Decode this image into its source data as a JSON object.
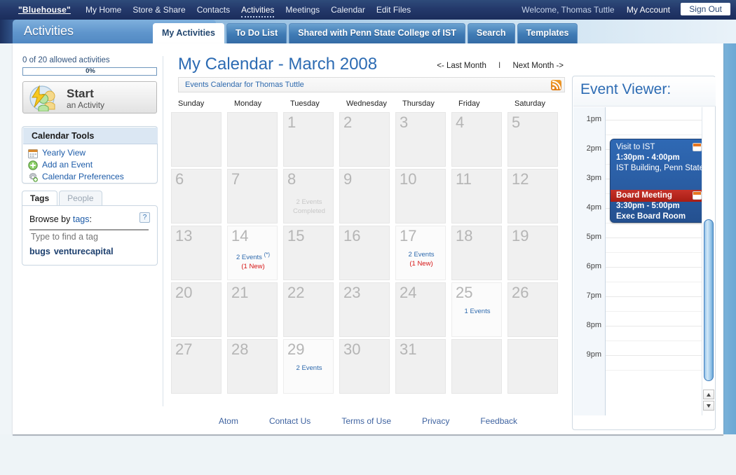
{
  "topnav": {
    "brand": "\"Bluehouse\"",
    "links": [
      {
        "label": "My Home",
        "active": false
      },
      {
        "label": "Store & Share",
        "active": false
      },
      {
        "label": "Contacts",
        "active": false
      },
      {
        "label": "Activities",
        "active": true
      },
      {
        "label": "Meetings",
        "active": false
      },
      {
        "label": "Calendar",
        "active": false
      },
      {
        "label": "Edit Files",
        "active": false
      }
    ],
    "welcome": "Welcome, Thomas Tuttle",
    "my_account": "My Account",
    "sign_out": "Sign Out"
  },
  "section": {
    "title": "Activities",
    "tabs": [
      {
        "label": "My Activities",
        "active": true
      },
      {
        "label": "To Do List",
        "active": false
      },
      {
        "label": "Shared with Penn State College of IST",
        "active": false
      },
      {
        "label": "Search",
        "active": false
      },
      {
        "label": "Templates",
        "active": false
      }
    ]
  },
  "sidebar": {
    "quota_text": "0 of 20 allowed activities",
    "quota_percent": "0%",
    "start_button": {
      "title": "Start",
      "subtitle": "an Activity",
      "icon": "start-activity-icon"
    },
    "tools_panel": {
      "heading": "Calendar Tools",
      "links": [
        {
          "label": "Yearly View",
          "icon": "calendar-icon"
        },
        {
          "label": "Add an Event",
          "icon": "plus-circle-icon"
        },
        {
          "label": "Calendar Preferences",
          "icon": "gear-icon"
        }
      ]
    },
    "tags_panel": {
      "tabs": [
        {
          "label": "Tags",
          "active": true
        },
        {
          "label": "People",
          "active": false
        }
      ],
      "browse_prefix": "Browse by ",
      "browse_link": "tags",
      "browse_suffix": ":",
      "help": "?",
      "tag_input_placeholder": "Type to find a tag",
      "tag_input_value": "",
      "tags": [
        "bugs",
        "venturecapital"
      ]
    }
  },
  "calendar": {
    "title": "My Calendar - March 2008",
    "prev_month": "<- Last Month",
    "separator": "I",
    "next_month": "Next Month ->",
    "feed_label": "Events Calendar for Thomas Tuttle",
    "feed_icon": "rss-icon",
    "day_headers": [
      "Sunday",
      "Monday",
      "Tuesday",
      "Wednesday",
      "Thursday",
      "Friday",
      "Saturday"
    ],
    "cells": [
      {
        "num": "",
        "events": "",
        "new": "",
        "star": false,
        "has": false
      },
      {
        "num": "",
        "events": "",
        "new": "",
        "star": false,
        "has": false
      },
      {
        "num": "1",
        "events": "",
        "new": "",
        "star": false,
        "has": false
      },
      {
        "num": "2",
        "events": "",
        "new": "",
        "star": false,
        "has": false
      },
      {
        "num": "3",
        "events": "",
        "new": "",
        "star": false,
        "has": false
      },
      {
        "num": "4",
        "events": "",
        "new": "",
        "star": false,
        "has": false
      },
      {
        "num": "5",
        "events": "",
        "new": "",
        "star": false,
        "has": false
      },
      {
        "num": "6",
        "events": "",
        "new": "",
        "star": false,
        "has": false
      },
      {
        "num": "7",
        "events": "",
        "new": "",
        "star": false,
        "has": false
      },
      {
        "num": "8",
        "events": "2 Events Completed",
        "new": "",
        "star": false,
        "has": false,
        "gray": true
      },
      {
        "num": "9",
        "events": "",
        "new": "",
        "star": false,
        "has": false
      },
      {
        "num": "10",
        "events": "",
        "new": "",
        "star": false,
        "has": false
      },
      {
        "num": "11",
        "events": "",
        "new": "",
        "star": false,
        "has": false
      },
      {
        "num": "12",
        "events": "",
        "new": "",
        "star": false,
        "has": false
      },
      {
        "num": "13",
        "events": "",
        "new": "",
        "star": false,
        "has": false
      },
      {
        "num": "14",
        "events": "2 Events",
        "new": "(1 New)",
        "star": true,
        "has": true
      },
      {
        "num": "15",
        "events": "",
        "new": "",
        "star": false,
        "has": false
      },
      {
        "num": "16",
        "events": "",
        "new": "",
        "star": false,
        "has": false
      },
      {
        "num": "17",
        "events": "2 Events",
        "new": "(1 New)",
        "star": false,
        "has": true
      },
      {
        "num": "18",
        "events": "",
        "new": "",
        "star": false,
        "has": false
      },
      {
        "num": "19",
        "events": "",
        "new": "",
        "star": false,
        "has": false
      },
      {
        "num": "20",
        "events": "",
        "new": "",
        "star": false,
        "has": false
      },
      {
        "num": "21",
        "events": "",
        "new": "",
        "star": false,
        "has": false
      },
      {
        "num": "22",
        "events": "",
        "new": "",
        "star": false,
        "has": false
      },
      {
        "num": "23",
        "events": "",
        "new": "",
        "star": false,
        "has": false
      },
      {
        "num": "24",
        "events": "",
        "new": "",
        "star": false,
        "has": false
      },
      {
        "num": "25",
        "events": "1 Events",
        "new": "",
        "star": false,
        "has": true
      },
      {
        "num": "26",
        "events": "",
        "new": "",
        "star": false,
        "has": false
      },
      {
        "num": "27",
        "events": "",
        "new": "",
        "star": false,
        "has": false
      },
      {
        "num": "28",
        "events": "",
        "new": "",
        "star": false,
        "has": false
      },
      {
        "num": "29",
        "events": "2 Events",
        "new": "",
        "star": false,
        "has": true
      },
      {
        "num": "30",
        "events": "",
        "new": "",
        "star": false,
        "has": false
      },
      {
        "num": "31",
        "events": "",
        "new": "",
        "star": false,
        "has": false
      },
      {
        "num": "",
        "events": "",
        "new": "",
        "star": false,
        "has": false
      },
      {
        "num": "",
        "events": "",
        "new": "",
        "star": false,
        "has": false
      }
    ]
  },
  "viewer": {
    "title": "Event Viewer:",
    "time_labels": [
      "1pm",
      "2pm",
      "3pm",
      "4pm",
      "5pm",
      "6pm",
      "7pm",
      "8pm",
      "9pm"
    ],
    "events": [
      {
        "title": "Visit to IST",
        "time": "1:30pm - 4:00pm",
        "location": "IST Building, Penn State",
        "color": "#2a5da3",
        "icon": "calendar-icon"
      },
      {
        "title": "Board Meeting",
        "time": "3:30pm - 5:00pm",
        "location": "Exec Board Room",
        "color": "#a81d14",
        "icon": "calendar-icon"
      }
    ]
  },
  "footer": {
    "links": [
      "Atom",
      "Contact Us",
      "Terms of Use",
      "Privacy",
      "Feedback"
    ]
  }
}
